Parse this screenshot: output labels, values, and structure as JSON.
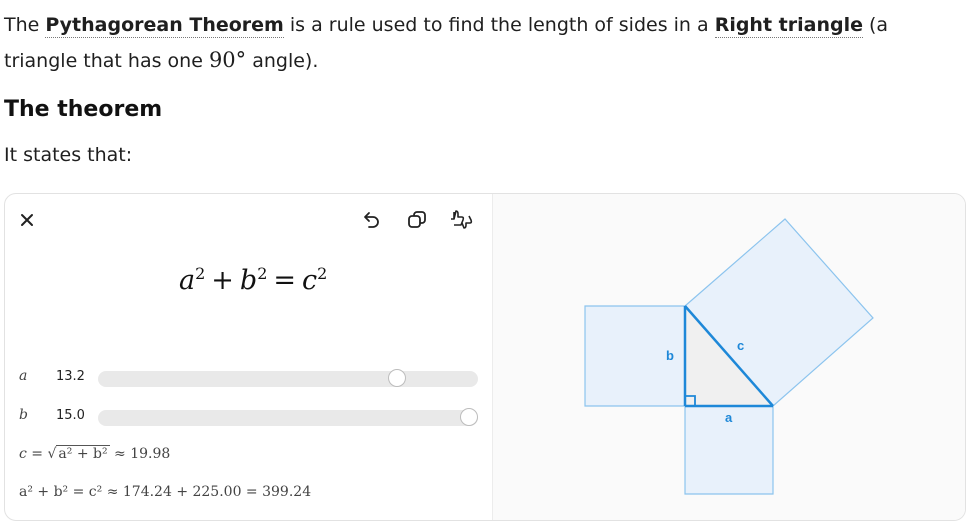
{
  "intro": {
    "part1": "The ",
    "term1": "Pythagorean Theorem",
    "part2": " is a rule used to find the length of sides in a ",
    "term2": "Right triangle",
    "part3": " (a triangle that has one ",
    "angle": "90°",
    "part4": " angle)."
  },
  "heading": "The theorem",
  "states": "It states that:",
  "widget": {
    "formula": {
      "a": "a",
      "b": "b",
      "c": "c",
      "exp": "2",
      "plus": "+",
      "eq": "="
    },
    "sliders": [
      {
        "var": "a",
        "value": "13.2",
        "fraction": 0.8
      },
      {
        "var": "b",
        "value": "15.0",
        "fraction": 1.0
      }
    ],
    "c_result": {
      "lhs": "c",
      "eq": "=",
      "radical": "a² + b²",
      "approx": "≈ 19.98"
    },
    "sum_result": {
      "text": "a² + b² = c² ≈ 174.24 + 225.00 = 399.24"
    },
    "diagram": {
      "label_a": "a",
      "label_b": "b",
      "label_c": "c"
    },
    "icons": [
      "close-icon",
      "undo-icon",
      "copy-icon",
      "feedback-icon"
    ]
  },
  "colors": {
    "accent": "#1e88d8",
    "square_fill": "#e8f1fb",
    "square_stroke": "#8cc4ee",
    "triangle_fill": "#f0f0f0"
  }
}
